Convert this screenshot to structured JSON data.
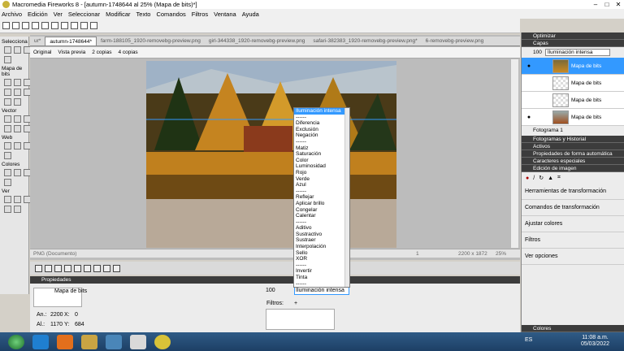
{
  "window": {
    "title": "Macromedia Fireworks 8 - [autumn-1748644 al  25% (Mapa de bits)*]"
  },
  "menu": [
    "Archivo",
    "Edición",
    "Ver",
    "Seleccionar",
    "Modificar",
    "Texto",
    "Comandos",
    "Filtros",
    "Ventana",
    "Ayuda"
  ],
  "tools": {
    "select": "Selecciona",
    "bitmap": "Mapa de bits",
    "vector": "Vector",
    "web": "Web",
    "colors": "Colores",
    "view": "Ver"
  },
  "tabs": [
    "ur*",
    "autumn-1748644*",
    "farm-188105_1920-removebg-preview.png",
    "girl-344338_1920-removebg-preview.png",
    "safari-382383_1920-removebg-preview.png*",
    "6-removebg-preview.png"
  ],
  "viewbar": {
    "original": "Original",
    "preview": "Vista previa",
    "two": "2 copias",
    "four": "4 copias"
  },
  "status": {
    "doc": "PNG (Documento)",
    "page": "1",
    "size": "2200 x 1872",
    "zoom": "25%"
  },
  "blend_menu": [
    "Iluminación intensa",
    "------",
    "Diferencia",
    "Exclusión",
    "Negación",
    "------",
    "Matiz",
    "Saturación",
    "Color",
    "Luminosidad",
    "Rojo",
    "Verde",
    "Azul",
    "------",
    "Reflejar",
    "Aplicar brillo",
    "Congelar",
    "Calentar",
    "------",
    "Aditivo",
    "Sustractivo",
    "Sustraer",
    "Interpolación",
    "Sello",
    "XOR",
    "------",
    "Invertir",
    "Tinta",
    "------",
    "Suprimir"
  ],
  "props": {
    "header": "Propiedades",
    "type": "Mapa de bits",
    "w_label": "An.:",
    "w": "2200",
    "x_label": "X:",
    "x": "0",
    "h_label": "Al.:",
    "h": "1170",
    "y_label": "Y:",
    "y": "684",
    "opacity": "100",
    "blend": "Iluminación intensa",
    "filters": "Filtros:"
  },
  "right": {
    "optimize": "Optimizar",
    "layers": "Capas",
    "opacity": "100",
    "blend": "Iluminación intensa",
    "layer_rows": [
      "Mapa de bits",
      "Mapa de bits",
      "Mapa de bits",
      "Mapa de bits"
    ],
    "frame": "Fotograma 1",
    "frames": "Fotogramas y Historial",
    "assets": "Activos",
    "auto": "Propiedades de forma automática",
    "chars": "Caracteres especiales",
    "edit": "Edición de imagen",
    "tools_list": [
      "Herramientas de transformación",
      "Comandos de transformación",
      "Ajustar colores",
      "Filtros",
      "Ver opciones"
    ],
    "colors": "Colores"
  },
  "taskbar": {
    "lang": "ES",
    "time": "11:08 a.m.",
    "date": "05/03/2022"
  }
}
